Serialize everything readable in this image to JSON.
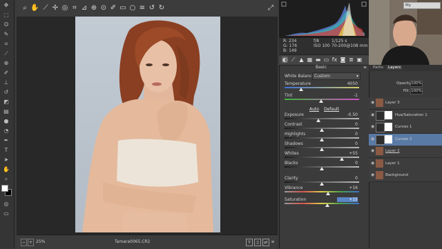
{
  "histogram": {
    "rgb_readout": [
      {
        "ch": "R:",
        "v": "234"
      },
      {
        "ch": "G:",
        "v": "176"
      },
      {
        "ch": "B:",
        "v": "149"
      }
    ],
    "camera": [
      {
        "a": "f/8",
        "b": "1/125 s"
      },
      {
        "a": "ISO 100",
        "b": "70-200@108 mm"
      }
    ]
  },
  "basic": {
    "section_title": "Basic",
    "white_balance_label": "White Balance:",
    "white_balance_value": "Custom",
    "auto_label": "Auto",
    "default_label": "Default",
    "sliders": [
      {
        "name": "Temperature",
        "value": "4050",
        "pos": 0.22
      },
      {
        "name": "Tint",
        "value": "-1",
        "pos": 0.49
      },
      {
        "name": "Exposure",
        "value": "-0.50",
        "pos": 0.45
      },
      {
        "name": "Contrast",
        "value": "0",
        "pos": 0.5
      },
      {
        "name": "Highlights",
        "value": "0",
        "pos": 0.5
      },
      {
        "name": "Shadows",
        "value": "0",
        "pos": 0.5
      },
      {
        "name": "Whites",
        "value": "+55",
        "pos": 0.77
      },
      {
        "name": "Blacks",
        "value": "0",
        "pos": 0.5
      },
      {
        "name": "Clarity",
        "value": "0",
        "pos": 0.5
      },
      {
        "name": "Vibrance",
        "value": "+16",
        "pos": 0.58
      },
      {
        "name": "Saturation",
        "value": "+15",
        "pos": 0.57
      }
    ]
  },
  "status": {
    "zoom": "25%",
    "filename": "Tamara0065.CR2"
  },
  "layers": {
    "search_text": "My",
    "tabs": [
      "Paths",
      "Layers"
    ],
    "opacity_label": "Opacity:",
    "opacity_value": "100%",
    "fill_label": "Fill:",
    "fill_value": "100%",
    "rows": [
      {
        "name": "Layer 3",
        "type": "pixel"
      },
      {
        "name": "Hue/Saturation 1",
        "type": "adj"
      },
      {
        "name": "Curves 1",
        "type": "adj"
      },
      {
        "name": "Curves 2",
        "type": "adj",
        "selected": true
      },
      {
        "name": "Layer 2",
        "type": "pixel",
        "underline": true
      },
      {
        "name": "Layer 1",
        "type": "pixel"
      },
      {
        "name": "Background",
        "type": "pixel"
      }
    ]
  },
  "colors": {
    "accent": "#5a86c5",
    "selected": "#5a7aa6"
  }
}
